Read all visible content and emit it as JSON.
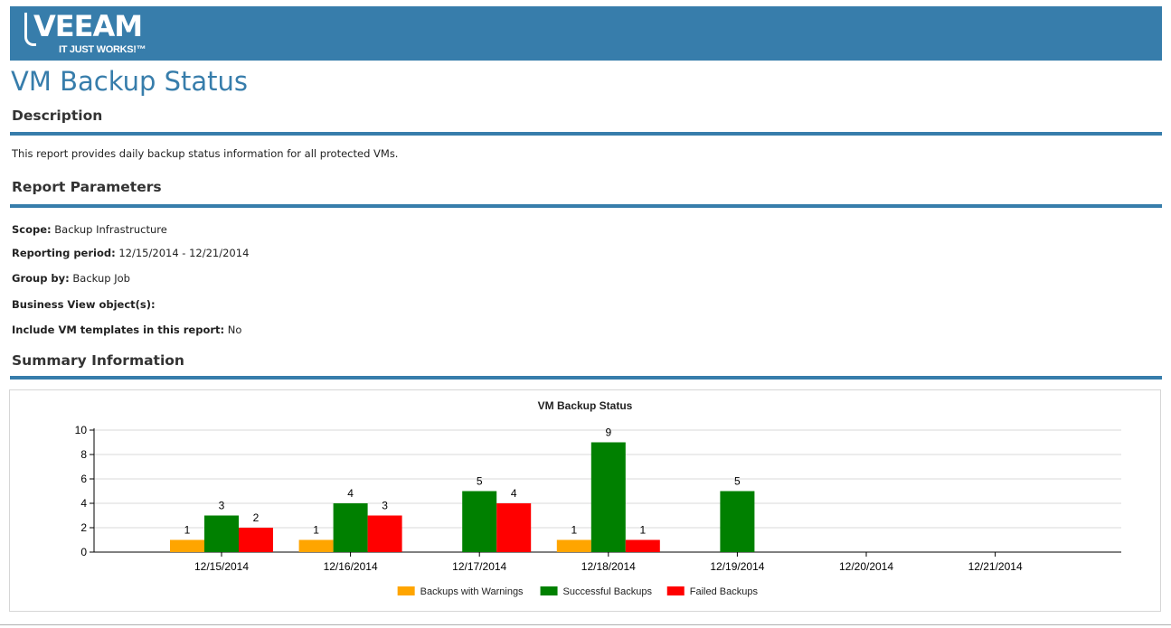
{
  "header": {
    "logo_text": "VEEAM",
    "logo_tagline": "IT JUST WORKS!™",
    "bar_color": "#377dab"
  },
  "page_title": "VM Backup Status",
  "description": {
    "heading": "Description",
    "text": "This report provides daily backup status information for all protected VMs."
  },
  "parameters": {
    "heading": "Report Parameters",
    "items": [
      {
        "label": "Scope:",
        "value": "Backup Infrastructure"
      },
      {
        "label": "Reporting period:",
        "value": "12/15/2014 - 12/21/2014"
      },
      {
        "label": "Group by:",
        "value": "Backup Job"
      },
      {
        "label": "Business View object(s):",
        "value": ""
      },
      {
        "label": "Include VM templates in this report:",
        "value": "No"
      }
    ]
  },
  "summary": {
    "heading": "Summary Information"
  },
  "chart_data": {
    "type": "bar",
    "title": "VM Backup Status",
    "xlabel": "",
    "ylabel": "",
    "ylim": [
      0,
      10
    ],
    "yticks": [
      0,
      2,
      4,
      6,
      8,
      10
    ],
    "grid": true,
    "legend_position": "bottom",
    "categories": [
      "12/15/2014",
      "12/16/2014",
      "12/17/2014",
      "12/18/2014",
      "12/19/2014",
      "12/20/2014",
      "12/21/2014"
    ],
    "series": [
      {
        "name": "Backups with Warnings",
        "color": "#ffa500",
        "values": [
          1,
          1,
          0,
          1,
          0,
          0,
          0
        ]
      },
      {
        "name": "Successful Backups",
        "color": "#008000",
        "values": [
          3,
          4,
          5,
          9,
          5,
          0,
          0
        ]
      },
      {
        "name": "Failed Backups",
        "color": "#ff0000",
        "values": [
          2,
          3,
          4,
          1,
          0,
          0,
          0
        ]
      }
    ]
  }
}
